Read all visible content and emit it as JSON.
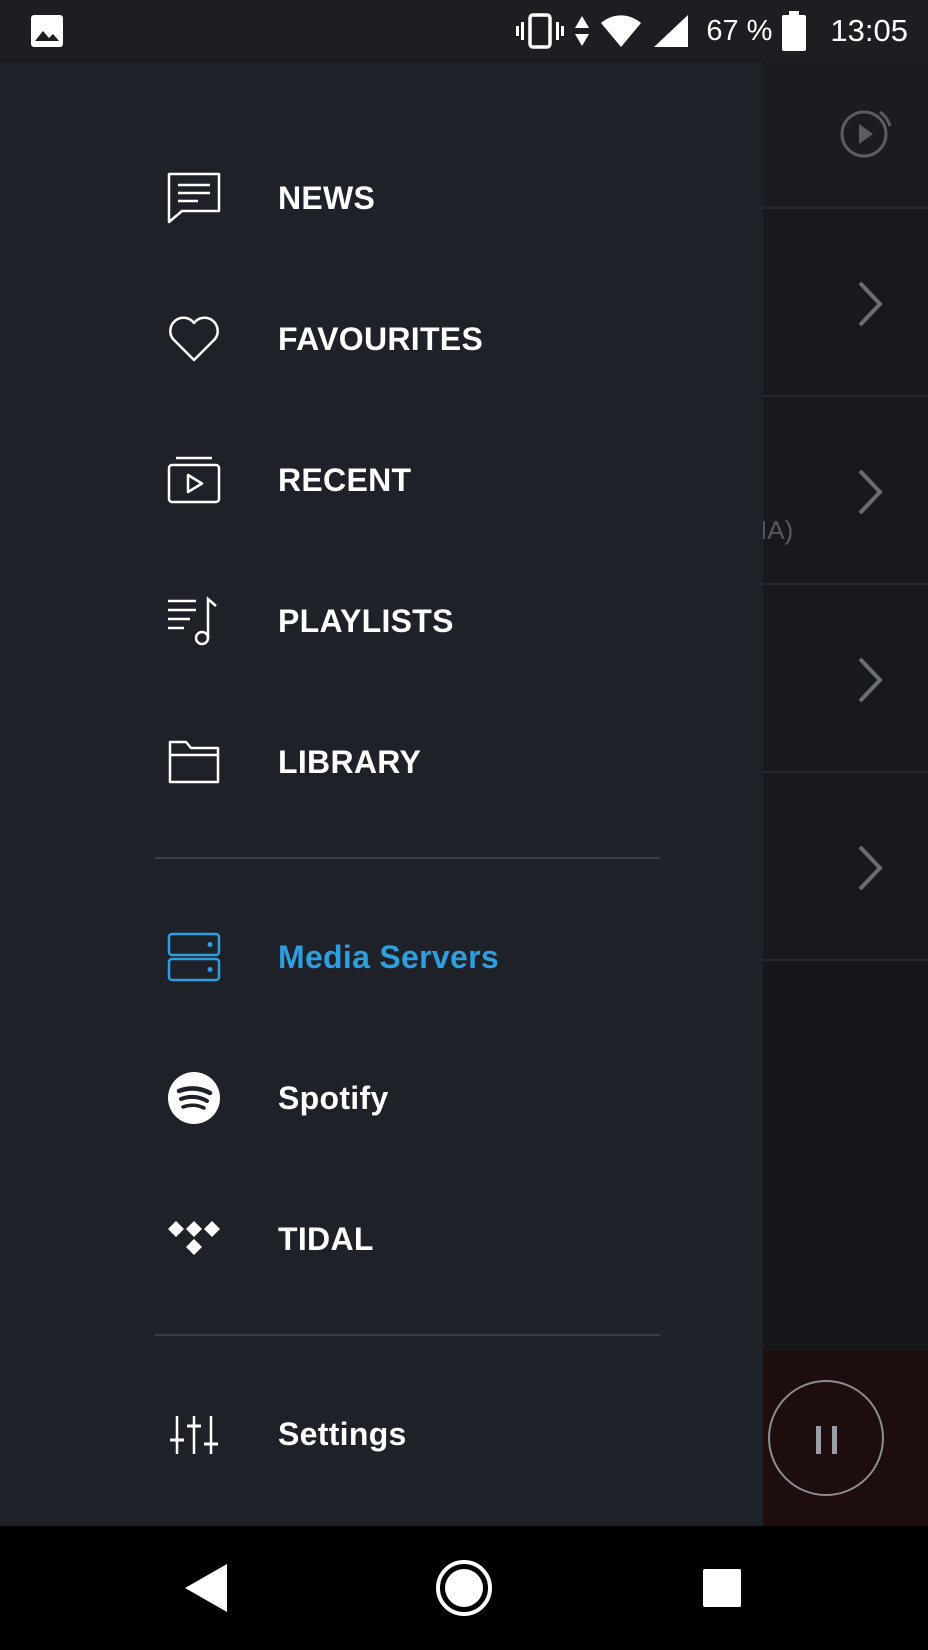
{
  "status_bar": {
    "battery_percent": "67 %",
    "time": "13:05"
  },
  "background_screen": {
    "partial_text": "IA)"
  },
  "drawer": {
    "items": [
      {
        "label": "NEWS",
        "icon": "news-icon"
      },
      {
        "label": "FAVOURITES",
        "icon": "heart-icon"
      },
      {
        "label": "RECENT",
        "icon": "recent-icon"
      },
      {
        "label": "PLAYLISTS",
        "icon": "playlist-icon"
      },
      {
        "label": "LIBRARY",
        "icon": "folder-icon"
      },
      {
        "label": "Media Servers",
        "icon": "server-icon",
        "active": true
      },
      {
        "label": "Spotify",
        "icon": "spotify-icon"
      },
      {
        "label": "TIDAL",
        "icon": "tidal-icon"
      },
      {
        "label": "Settings",
        "icon": "sliders-icon"
      }
    ]
  },
  "colors": {
    "drawer_bg": "#1f2129",
    "accent": "#2d9fde",
    "text": "#ffffff"
  }
}
